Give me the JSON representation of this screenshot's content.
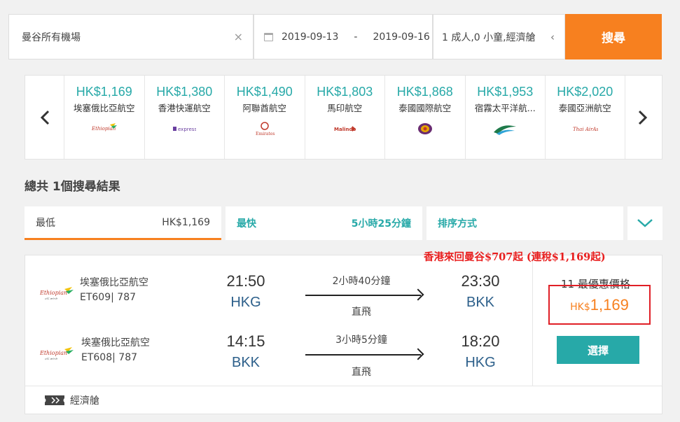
{
  "search": {
    "destination": "曼谷所有機場",
    "clear_icon": "×",
    "date_from": "2019-09-13",
    "date_sep": "-",
    "date_to": "2019-09-16",
    "passengers": "1 成人,0 小童,經濟艙",
    "chevron": "‹",
    "search_label": "搜尋"
  },
  "carousel": {
    "prev": "‹",
    "next": "›",
    "airlines": [
      {
        "price": "HK$1,169",
        "name": "埃塞俄比亞航空",
        "logo": "ethiopian-logo"
      },
      {
        "price": "HK$1,380",
        "name": "香港快運航空",
        "logo": "hkexpress-logo"
      },
      {
        "price": "HK$1,490",
        "name": "阿聯酋航空",
        "logo": "emirates-logo"
      },
      {
        "price": "HK$1,803",
        "name": "馬印航空",
        "logo": "malindo-logo"
      },
      {
        "price": "HK$1,868",
        "name": "泰國國際航空",
        "logo": "thai-logo"
      },
      {
        "price": "HK$1,953",
        "name": "宿霧太平洋航...",
        "logo": "cebu-logo"
      },
      {
        "price": "HK$2,020",
        "name": "泰國亞洲航空",
        "logo": "thaiairasia-logo"
      }
    ]
  },
  "results": {
    "count_label": "總共 1個搜尋結果"
  },
  "sort": {
    "cheapest_label": "最低",
    "cheapest_value": "HK$1,169",
    "fastest_label": "最快",
    "fastest_value": "5小時25分鐘",
    "sort_label": "排序方式"
  },
  "promo": "香港來回曼谷$707起 (連稅$1,169起)",
  "flight": {
    "outbound": {
      "airline": "埃塞俄比亞航空",
      "code": "ET609| 787",
      "depart_time": "21:50",
      "depart_airport": "HKG",
      "duration": "2小時40分鐘",
      "type": "直飛",
      "arrive_time": "23:30",
      "arrive_airport": "BKK"
    },
    "inbound": {
      "airline": "埃塞俄比亞航空",
      "code": "ET608| 787",
      "depart_time": "14:15",
      "depart_airport": "BKK",
      "duration": "3小時5分鐘",
      "type": "直飛",
      "arrive_time": "18:20",
      "arrive_airport": "HKG"
    },
    "deals_label": "11 最優惠價格",
    "price_currency": "HK$",
    "price_value": "1,169",
    "select_label": "選擇",
    "cabin": "經濟艙"
  },
  "colors": {
    "accent_orange": "#f7801f",
    "teal": "#27a9a8",
    "highlight_red": "#e01f26"
  }
}
